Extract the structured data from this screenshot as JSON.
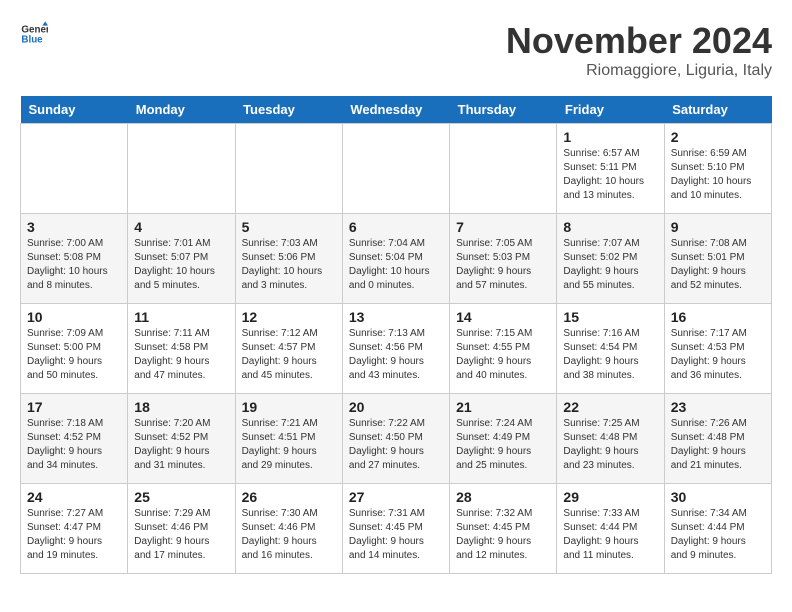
{
  "header": {
    "logo_general": "General",
    "logo_blue": "Blue",
    "title": "November 2024",
    "subtitle": "Riomaggiore, Liguria, Italy"
  },
  "days_of_week": [
    "Sunday",
    "Monday",
    "Tuesday",
    "Wednesday",
    "Thursday",
    "Friday",
    "Saturday"
  ],
  "weeks": [
    [
      {
        "day": "",
        "sunrise": "",
        "sunset": "",
        "daylight": ""
      },
      {
        "day": "",
        "sunrise": "",
        "sunset": "",
        "daylight": ""
      },
      {
        "day": "",
        "sunrise": "",
        "sunset": "",
        "daylight": ""
      },
      {
        "day": "",
        "sunrise": "",
        "sunset": "",
        "daylight": ""
      },
      {
        "day": "",
        "sunrise": "",
        "sunset": "",
        "daylight": ""
      },
      {
        "day": "1",
        "sunrise": "Sunrise: 6:57 AM",
        "sunset": "Sunset: 5:11 PM",
        "daylight": "Daylight: 10 hours and 13 minutes."
      },
      {
        "day": "2",
        "sunrise": "Sunrise: 6:59 AM",
        "sunset": "Sunset: 5:10 PM",
        "daylight": "Daylight: 10 hours and 10 minutes."
      }
    ],
    [
      {
        "day": "3",
        "sunrise": "Sunrise: 7:00 AM",
        "sunset": "Sunset: 5:08 PM",
        "daylight": "Daylight: 10 hours and 8 minutes."
      },
      {
        "day": "4",
        "sunrise": "Sunrise: 7:01 AM",
        "sunset": "Sunset: 5:07 PM",
        "daylight": "Daylight: 10 hours and 5 minutes."
      },
      {
        "day": "5",
        "sunrise": "Sunrise: 7:03 AM",
        "sunset": "Sunset: 5:06 PM",
        "daylight": "Daylight: 10 hours and 3 minutes."
      },
      {
        "day": "6",
        "sunrise": "Sunrise: 7:04 AM",
        "sunset": "Sunset: 5:04 PM",
        "daylight": "Daylight: 10 hours and 0 minutes."
      },
      {
        "day": "7",
        "sunrise": "Sunrise: 7:05 AM",
        "sunset": "Sunset: 5:03 PM",
        "daylight": "Daylight: 9 hours and 57 minutes."
      },
      {
        "day": "8",
        "sunrise": "Sunrise: 7:07 AM",
        "sunset": "Sunset: 5:02 PM",
        "daylight": "Daylight: 9 hours and 55 minutes."
      },
      {
        "day": "9",
        "sunrise": "Sunrise: 7:08 AM",
        "sunset": "Sunset: 5:01 PM",
        "daylight": "Daylight: 9 hours and 52 minutes."
      }
    ],
    [
      {
        "day": "10",
        "sunrise": "Sunrise: 7:09 AM",
        "sunset": "Sunset: 5:00 PM",
        "daylight": "Daylight: 9 hours and 50 minutes."
      },
      {
        "day": "11",
        "sunrise": "Sunrise: 7:11 AM",
        "sunset": "Sunset: 4:58 PM",
        "daylight": "Daylight: 9 hours and 47 minutes."
      },
      {
        "day": "12",
        "sunrise": "Sunrise: 7:12 AM",
        "sunset": "Sunset: 4:57 PM",
        "daylight": "Daylight: 9 hours and 45 minutes."
      },
      {
        "day": "13",
        "sunrise": "Sunrise: 7:13 AM",
        "sunset": "Sunset: 4:56 PM",
        "daylight": "Daylight: 9 hours and 43 minutes."
      },
      {
        "day": "14",
        "sunrise": "Sunrise: 7:15 AM",
        "sunset": "Sunset: 4:55 PM",
        "daylight": "Daylight: 9 hours and 40 minutes."
      },
      {
        "day": "15",
        "sunrise": "Sunrise: 7:16 AM",
        "sunset": "Sunset: 4:54 PM",
        "daylight": "Daylight: 9 hours and 38 minutes."
      },
      {
        "day": "16",
        "sunrise": "Sunrise: 7:17 AM",
        "sunset": "Sunset: 4:53 PM",
        "daylight": "Daylight: 9 hours and 36 minutes."
      }
    ],
    [
      {
        "day": "17",
        "sunrise": "Sunrise: 7:18 AM",
        "sunset": "Sunset: 4:52 PM",
        "daylight": "Daylight: 9 hours and 34 minutes."
      },
      {
        "day": "18",
        "sunrise": "Sunrise: 7:20 AM",
        "sunset": "Sunset: 4:52 PM",
        "daylight": "Daylight: 9 hours and 31 minutes."
      },
      {
        "day": "19",
        "sunrise": "Sunrise: 7:21 AM",
        "sunset": "Sunset: 4:51 PM",
        "daylight": "Daylight: 9 hours and 29 minutes."
      },
      {
        "day": "20",
        "sunrise": "Sunrise: 7:22 AM",
        "sunset": "Sunset: 4:50 PM",
        "daylight": "Daylight: 9 hours and 27 minutes."
      },
      {
        "day": "21",
        "sunrise": "Sunrise: 7:24 AM",
        "sunset": "Sunset: 4:49 PM",
        "daylight": "Daylight: 9 hours and 25 minutes."
      },
      {
        "day": "22",
        "sunrise": "Sunrise: 7:25 AM",
        "sunset": "Sunset: 4:48 PM",
        "daylight": "Daylight: 9 hours and 23 minutes."
      },
      {
        "day": "23",
        "sunrise": "Sunrise: 7:26 AM",
        "sunset": "Sunset: 4:48 PM",
        "daylight": "Daylight: 9 hours and 21 minutes."
      }
    ],
    [
      {
        "day": "24",
        "sunrise": "Sunrise: 7:27 AM",
        "sunset": "Sunset: 4:47 PM",
        "daylight": "Daylight: 9 hours and 19 minutes."
      },
      {
        "day": "25",
        "sunrise": "Sunrise: 7:29 AM",
        "sunset": "Sunset: 4:46 PM",
        "daylight": "Daylight: 9 hours and 17 minutes."
      },
      {
        "day": "26",
        "sunrise": "Sunrise: 7:30 AM",
        "sunset": "Sunset: 4:46 PM",
        "daylight": "Daylight: 9 hours and 16 minutes."
      },
      {
        "day": "27",
        "sunrise": "Sunrise: 7:31 AM",
        "sunset": "Sunset: 4:45 PM",
        "daylight": "Daylight: 9 hours and 14 minutes."
      },
      {
        "day": "28",
        "sunrise": "Sunrise: 7:32 AM",
        "sunset": "Sunset: 4:45 PM",
        "daylight": "Daylight: 9 hours and 12 minutes."
      },
      {
        "day": "29",
        "sunrise": "Sunrise: 7:33 AM",
        "sunset": "Sunset: 4:44 PM",
        "daylight": "Daylight: 9 hours and 11 minutes."
      },
      {
        "day": "30",
        "sunrise": "Sunrise: 7:34 AM",
        "sunset": "Sunset: 4:44 PM",
        "daylight": "Daylight: 9 hours and 9 minutes."
      }
    ]
  ]
}
